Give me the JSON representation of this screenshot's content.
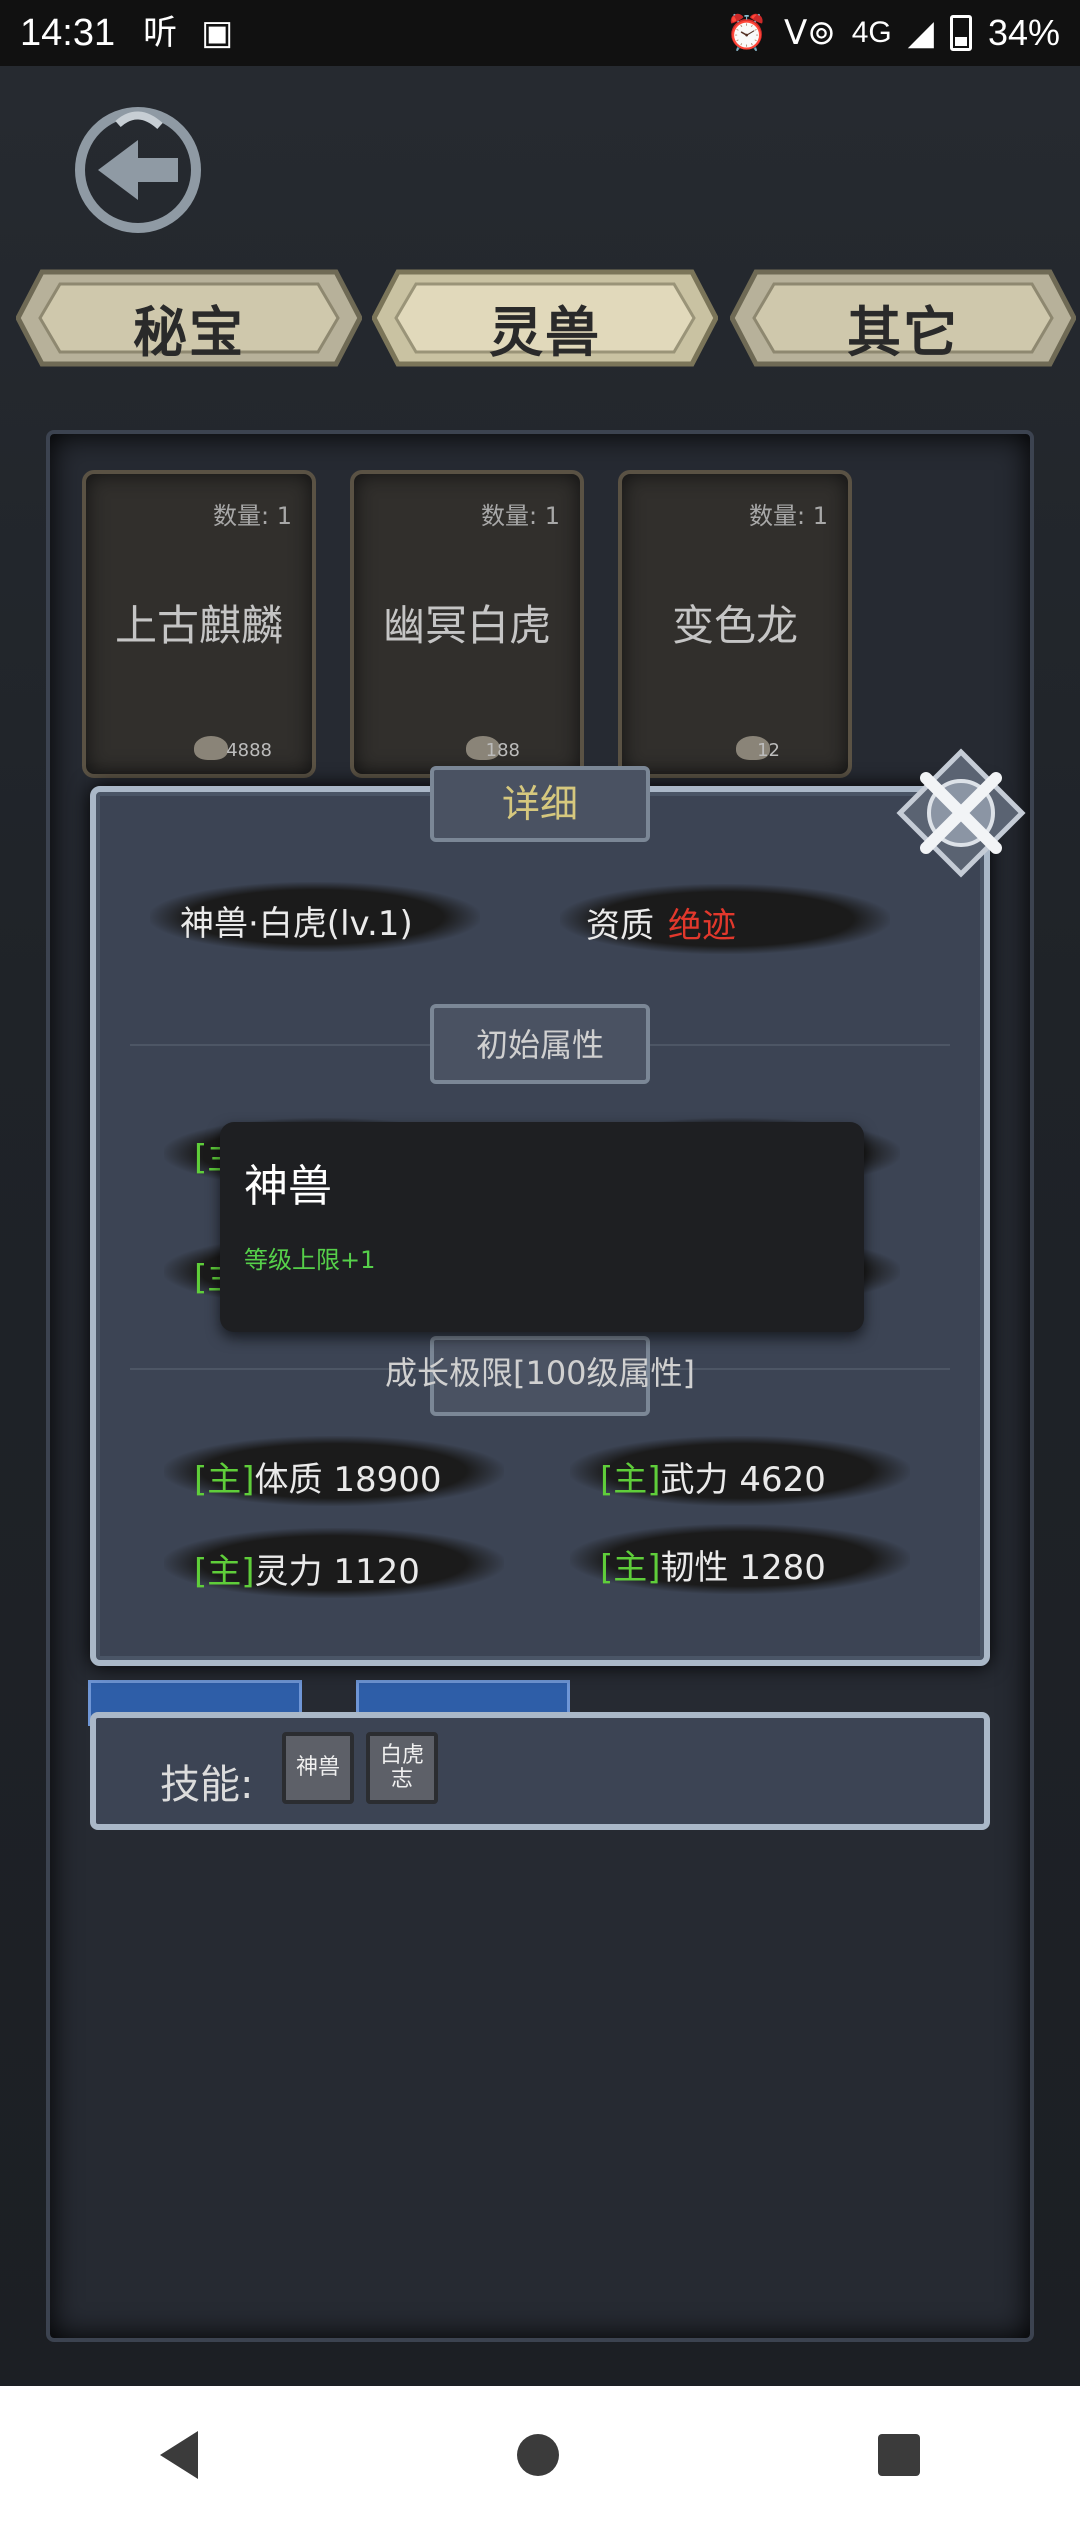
{
  "status_bar": {
    "time": "14:31",
    "net": "4G",
    "battery_percent": "34%",
    "battery_level": 0.34
  },
  "tabs": [
    {
      "label": "秘宝"
    },
    {
      "label": "灵兽"
    },
    {
      "label": "其它"
    }
  ],
  "cards": [
    {
      "qty": "数量: 1",
      "name": "上古麒麟",
      "count": "4888"
    },
    {
      "qty": "数量: 1",
      "name": "幽冥白虎",
      "count": "188"
    },
    {
      "qty": "数量: 1",
      "name": "变色龙",
      "count": "12"
    }
  ],
  "dialog": {
    "title": "详细",
    "beast_name": "神兽·白虎(lv.1)",
    "quality_label": "资质",
    "quality_value": "绝迹",
    "initial_attr_label": "初始属性",
    "growth_label": "成长极限[100级属性]",
    "stats": [
      {
        "tag": "[主]",
        "name": "体质",
        "value": "18900"
      },
      {
        "tag": "[主]",
        "name": "武力",
        "value": "4620"
      },
      {
        "tag": "[主]",
        "name": "灵力",
        "value": "1120"
      },
      {
        "tag": "[主]",
        "name": "韧性",
        "value": "1280"
      }
    ],
    "hidden_tags": [
      "[主",
      "[主"
    ]
  },
  "tooltip": {
    "title": "神兽",
    "desc": "等级上限+1"
  },
  "skills": {
    "label": "技能:",
    "items": [
      {
        "text": "神兽"
      },
      {
        "text": "白虎志"
      }
    ]
  }
}
